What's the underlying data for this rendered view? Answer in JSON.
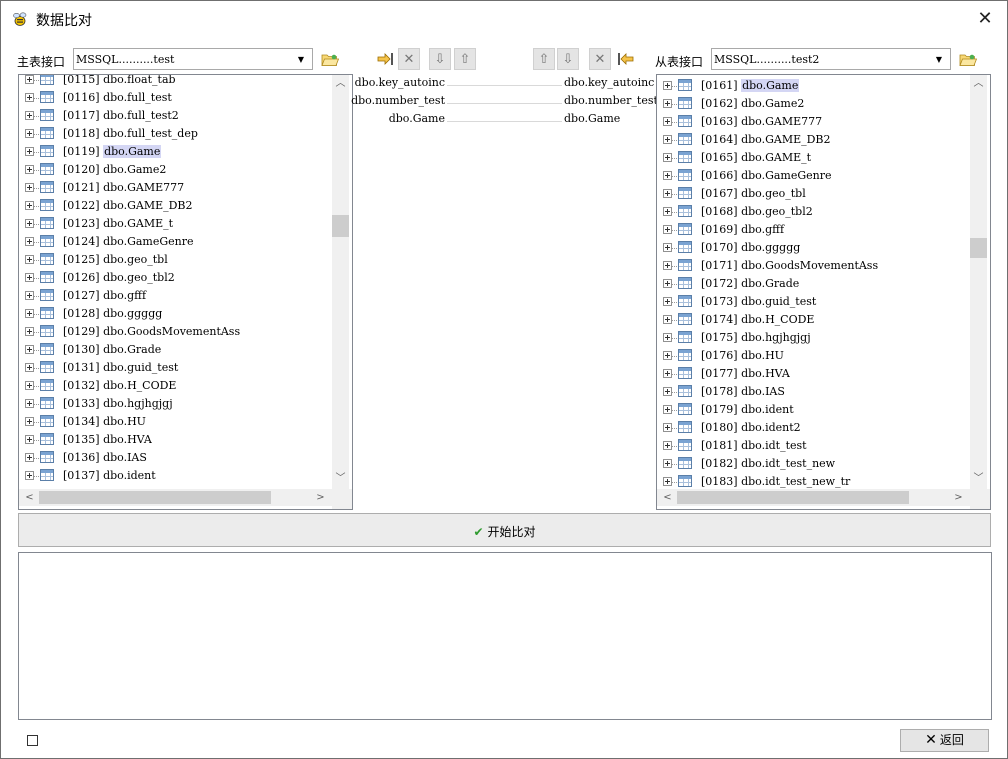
{
  "window": {
    "title": "数据比对",
    "close_glyph": "✕"
  },
  "master": {
    "label": "主表接口",
    "combo_value": "MSSQL..........test",
    "rows": [
      {
        "index": "[0115]",
        "name": "dbo.float_tab",
        "selected": false
      },
      {
        "index": "[0116]",
        "name": "dbo.full_test",
        "selected": false
      },
      {
        "index": "[0117]",
        "name": "dbo.full_test2",
        "selected": false
      },
      {
        "index": "[0118]",
        "name": "dbo.full_test_dep",
        "selected": false
      },
      {
        "index": "[0119]",
        "name": "dbo.Game",
        "selected": true
      },
      {
        "index": "[0120]",
        "name": "dbo.Game2",
        "selected": false
      },
      {
        "index": "[0121]",
        "name": "dbo.GAME777",
        "selected": false
      },
      {
        "index": "[0122]",
        "name": "dbo.GAME_DB2",
        "selected": false
      },
      {
        "index": "[0123]",
        "name": "dbo.GAME_t",
        "selected": false
      },
      {
        "index": "[0124]",
        "name": "dbo.GameGenre",
        "selected": false
      },
      {
        "index": "[0125]",
        "name": "dbo.geo_tbl",
        "selected": false
      },
      {
        "index": "[0126]",
        "name": "dbo.geo_tbl2",
        "selected": false
      },
      {
        "index": "[0127]",
        "name": "dbo.gfff",
        "selected": false
      },
      {
        "index": "[0128]",
        "name": "dbo.ggggg",
        "selected": false
      },
      {
        "index": "[0129]",
        "name": "dbo.GoodsMovementAss",
        "selected": false
      },
      {
        "index": "[0130]",
        "name": "dbo.Grade",
        "selected": false
      },
      {
        "index": "[0131]",
        "name": "dbo.guid_test",
        "selected": false
      },
      {
        "index": "[0132]",
        "name": "dbo.H_CODE",
        "selected": false
      },
      {
        "index": "[0133]",
        "name": "dbo.hgjhgjgj",
        "selected": false
      },
      {
        "index": "[0134]",
        "name": "dbo.HU",
        "selected": false
      },
      {
        "index": "[0135]",
        "name": "dbo.HVA",
        "selected": false
      },
      {
        "index": "[0136]",
        "name": "dbo.IAS",
        "selected": false
      },
      {
        "index": "[0137]",
        "name": "dbo.ident",
        "selected": false
      }
    ]
  },
  "slave": {
    "label": "从表接口",
    "combo_value": "MSSQL..........test2",
    "rows": [
      {
        "index": "[0161]",
        "name": "dbo.Game",
        "selected": true
      },
      {
        "index": "[0162]",
        "name": "dbo.Game2",
        "selected": false
      },
      {
        "index": "[0163]",
        "name": "dbo.GAME777",
        "selected": false
      },
      {
        "index": "[0164]",
        "name": "dbo.GAME_DB2",
        "selected": false
      },
      {
        "index": "[0165]",
        "name": "dbo.GAME_t",
        "selected": false
      },
      {
        "index": "[0166]",
        "name": "dbo.GameGenre",
        "selected": false
      },
      {
        "index": "[0167]",
        "name": "dbo.geo_tbl",
        "selected": false
      },
      {
        "index": "[0168]",
        "name": "dbo.geo_tbl2",
        "selected": false
      },
      {
        "index": "[0169]",
        "name": "dbo.gfff",
        "selected": false
      },
      {
        "index": "[0170]",
        "name": "dbo.ggggg",
        "selected": false
      },
      {
        "index": "[0171]",
        "name": "dbo.GoodsMovementAss",
        "selected": false
      },
      {
        "index": "[0172]",
        "name": "dbo.Grade",
        "selected": false
      },
      {
        "index": "[0173]",
        "name": "dbo.guid_test",
        "selected": false
      },
      {
        "index": "[0174]",
        "name": "dbo.H_CODE",
        "selected": false
      },
      {
        "index": "[0175]",
        "name": "dbo.hgjhgjgj",
        "selected": false
      },
      {
        "index": "[0176]",
        "name": "dbo.HU",
        "selected": false
      },
      {
        "index": "[0177]",
        "name": "dbo.HVA",
        "selected": false
      },
      {
        "index": "[0178]",
        "name": "dbo.IAS",
        "selected": false
      },
      {
        "index": "[0179]",
        "name": "dbo.ident",
        "selected": false
      },
      {
        "index": "[0180]",
        "name": "dbo.ident2",
        "selected": false
      },
      {
        "index": "[0181]",
        "name": "dbo.idt_test",
        "selected": false
      },
      {
        "index": "[0182]",
        "name": "dbo.idt_test_new",
        "selected": false
      },
      {
        "index": "[0183]",
        "name": "dbo.idt_test_new_tr",
        "selected": false
      }
    ]
  },
  "mappings": [
    {
      "left": "dbo.key_autoinc",
      "right": "dbo.key_autoinc"
    },
    {
      "left": "dbo.number_test",
      "right": "dbo.number_test"
    },
    {
      "left": "dbo.Game",
      "right": "dbo.Game"
    }
  ],
  "toolbar": {
    "add_icon": "arrow-right-into-bar-icon",
    "delete_icon": "delete-x-icon",
    "down_icon": "arrow-down-icon",
    "up_icon": "arrow-up-icon",
    "back_add_icon": "arrow-left-into-bar-icon"
  },
  "actions": {
    "start_compare": "开始比对",
    "back": "返回"
  },
  "colors": {
    "selection": "#d4d6f4",
    "check_green": "#2e9b2e"
  }
}
